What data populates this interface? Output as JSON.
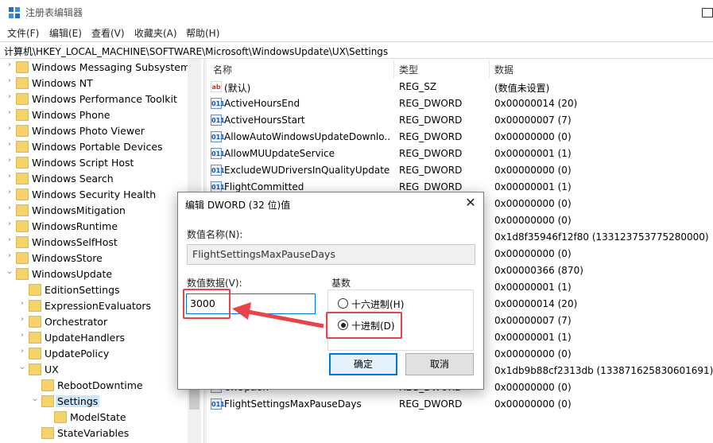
{
  "window": {
    "title": "注册表编辑器",
    "icon": "regedit-icon"
  },
  "menu": [
    "文件(F)",
    "编辑(E)",
    "查看(V)",
    "收藏夹(A)",
    "帮助(H)"
  ],
  "address": "计算机\\HKEY_LOCAL_MACHINE\\SOFTWARE\\Microsoft\\WindowsUpdate\\UX\\Settings",
  "tree": [
    {
      "label": "Windows Messaging Subsystem",
      "level": 0,
      "expander": ">"
    },
    {
      "label": "Windows NT",
      "level": 0,
      "expander": ">"
    },
    {
      "label": "Windows Performance Toolkit",
      "level": 0,
      "expander": ">"
    },
    {
      "label": "Windows Phone",
      "level": 0,
      "expander": ">"
    },
    {
      "label": "Windows Photo Viewer",
      "level": 0,
      "expander": ">"
    },
    {
      "label": "Windows Portable Devices",
      "level": 0,
      "expander": ">"
    },
    {
      "label": "Windows Script Host",
      "level": 0,
      "expander": ">"
    },
    {
      "label": "Windows Search",
      "level": 0,
      "expander": ">"
    },
    {
      "label": "Windows Security Health",
      "level": 0,
      "expander": ">"
    },
    {
      "label": "WindowsMitigation",
      "level": 0,
      "expander": ">"
    },
    {
      "label": "WindowsRuntime",
      "level": 0,
      "expander": ">"
    },
    {
      "label": "WindowsSelfHost",
      "level": 0,
      "expander": ">"
    },
    {
      "label": "WindowsStore",
      "level": 0,
      "expander": ">"
    },
    {
      "label": "WindowsUpdate",
      "level": 0,
      "expander": "v"
    },
    {
      "label": "EditionSettings",
      "level": 1,
      "expander": ""
    },
    {
      "label": "ExpressionEvaluators",
      "level": 1,
      "expander": ">"
    },
    {
      "label": "Orchestrator",
      "level": 1,
      "expander": ">"
    },
    {
      "label": "UpdateHandlers",
      "level": 1,
      "expander": ">"
    },
    {
      "label": "UpdatePolicy",
      "level": 1,
      "expander": ">"
    },
    {
      "label": "UX",
      "level": 1,
      "expander": "v"
    },
    {
      "label": "RebootDowntime",
      "level": 2,
      "expander": ""
    },
    {
      "label": "Settings",
      "level": 2,
      "expander": "v",
      "selected": true
    },
    {
      "label": "ModelState",
      "level": 3,
      "expander": ""
    },
    {
      "label": "StateVariables",
      "level": 2,
      "expander": ""
    }
  ],
  "columns": {
    "name": "名称",
    "type": "类型",
    "data": "数据"
  },
  "values": [
    {
      "name": "(默认)",
      "type": "REG_SZ",
      "data": "(数值未设置)",
      "icon": "ab"
    },
    {
      "name": "ActiveHoursEnd",
      "type": "REG_DWORD",
      "data": "0x00000014 (20)",
      "icon": "bin"
    },
    {
      "name": "ActiveHoursStart",
      "type": "REG_DWORD",
      "data": "0x00000007 (7)",
      "icon": "bin"
    },
    {
      "name": "AllowAutoWindowsUpdateDownlo...",
      "type": "REG_DWORD",
      "data": "0x00000000 (0)",
      "icon": "bin"
    },
    {
      "name": "AllowMUUpdateService",
      "type": "REG_DWORD",
      "data": "0x00000001 (1)",
      "icon": "bin"
    },
    {
      "name": "ExcludeWUDriversInQualityUpdate",
      "type": "REG_DWORD",
      "data": "0x00000000 (0)",
      "icon": "bin"
    },
    {
      "name": "FlightCommitted",
      "type": "REG_DWORD",
      "data": "0x00000001 (1)",
      "icon": "bin"
    },
    {
      "name": "",
      "type": "",
      "data": "0x00000000 (0)",
      "icon": ""
    },
    {
      "name": "",
      "type": "",
      "data": "0x00000000 (0)",
      "icon": ""
    },
    {
      "name": "",
      "type": "",
      "data": "0x1d8f35946f12f80 (133123753775280000)",
      "icon": ""
    },
    {
      "name": "",
      "type": "",
      "data": "0x00000000 (0)",
      "icon": ""
    },
    {
      "name": "",
      "type": "",
      "data": "0x00000366 (870)",
      "icon": ""
    },
    {
      "name": "",
      "type": "",
      "data": "0x00000001 (1)",
      "icon": ""
    },
    {
      "name": "",
      "type": "",
      "data": "0x00000014 (20)",
      "icon": ""
    },
    {
      "name": "",
      "type": "",
      "data": "0x00000007 (7)",
      "icon": ""
    },
    {
      "name": "",
      "type": "",
      "data": "0x00000001 (1)",
      "icon": ""
    },
    {
      "name": "",
      "type": "",
      "data": "0x00000000 (0)",
      "icon": ""
    },
    {
      "name": "",
      "type": "",
      "data": "0x1db9b88cf2313db (133871625830601691)",
      "icon": ""
    },
    {
      "name": "UxOption",
      "type": "REG_DWORD",
      "data": "0x00000000 (0)",
      "icon": "bin"
    },
    {
      "name": "FlightSettingsMaxPauseDays",
      "type": "REG_DWORD",
      "data": "0x00000000 (0)",
      "icon": "bin"
    }
  ],
  "dialog": {
    "title": "编辑 DWORD (32 位)值",
    "name_label": "数值名称(N):",
    "name_value": "FlightSettingsMaxPauseDays",
    "data_label": "数值数据(V):",
    "data_value": "3000",
    "base_label": "基数",
    "hex_label": "十六进制(H)",
    "dec_label": "十进制(D)",
    "base_selected": "decimal",
    "ok_label": "确定",
    "cancel_label": "取消"
  },
  "annotation_color": "#e8424a"
}
